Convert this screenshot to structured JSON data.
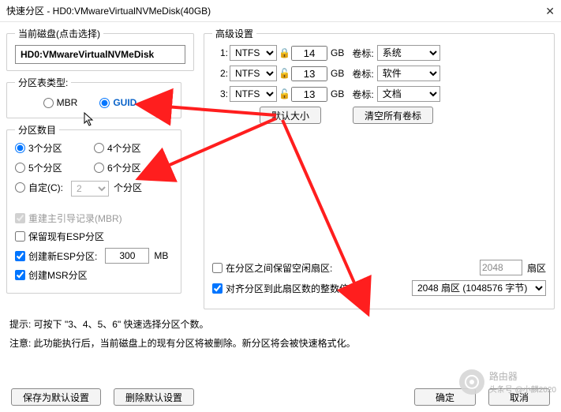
{
  "title": "快速分区 - HD0:VMwareVirtualNVMeDisk(40GB)",
  "current_disk": {
    "legend": "当前磁盘(点击选择)",
    "name": "HD0:VMwareVirtualNVMeDisk"
  },
  "table_type": {
    "legend": "分区表类型:",
    "mbr": "MBR",
    "guid": "GUID",
    "selected": "GUID"
  },
  "part_count": {
    "legend": "分区数目",
    "opts": [
      "3个分区",
      "4个分区",
      "5个分区",
      "6个分区"
    ],
    "custom_label": "自定(C):",
    "custom_val": "2",
    "custom_unit": "个分区",
    "selected_index": 0
  },
  "options": {
    "rebuild_mbr": "重建主引导记录(MBR)",
    "keep_esp": "保留现有ESP分区",
    "new_esp": "创建新ESP分区:",
    "esp_size": "300",
    "esp_unit": "MB",
    "create_msr": "创建MSR分区"
  },
  "advanced": {
    "legend": "高级设置",
    "rows": [
      {
        "idx": "1:",
        "fs": "NTFS",
        "lock": true,
        "size": "14",
        "unit": "GB",
        "label_lbl": "卷标:",
        "label": "系统"
      },
      {
        "idx": "2:",
        "fs": "NTFS",
        "lock": false,
        "size": "13",
        "unit": "GB",
        "label_lbl": "卷标:",
        "label": "软件"
      },
      {
        "idx": "3:",
        "fs": "NTFS",
        "lock": false,
        "size": "13",
        "unit": "GB",
        "label_lbl": "卷标:",
        "label": "文档"
      }
    ],
    "btn_default_size": "默认大小",
    "btn_clear_labels": "清空所有卷标"
  },
  "gap": {
    "label": "在分区之间保留空闲扇区:",
    "value": "2048",
    "unit": "扇区"
  },
  "align": {
    "label": "对齐分区到此扇区数的整数倍:",
    "value": "2048 扇区 (1048576 字节)"
  },
  "hints": {
    "h1": "提示: 可按下 \"3、4、5、6\" 快速选择分区个数。",
    "h2": "注意: 此功能执行后，当前磁盘上的现有分区将被删除。新分区将会被快速格式化。"
  },
  "buttons": {
    "save": "保存为默认设置",
    "del": "删除默认设置",
    "ok": "确定",
    "cancel": "取消"
  },
  "watermark": {
    "brand": "路由器",
    "author": "头条号 @小麟2020"
  }
}
